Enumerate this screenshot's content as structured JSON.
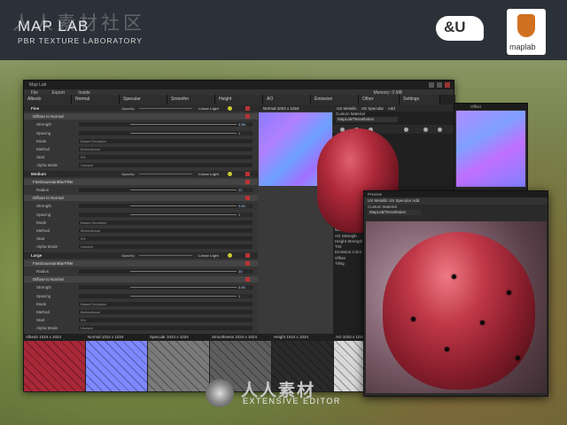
{
  "banner": {
    "title": "MAP LAB",
    "subtitle": "PBR TEXTURE LABORATORY",
    "watermark": "人人素材社区",
    "logo_amp": "&U",
    "logo_maplab": "maplab"
  },
  "main_window": {
    "title": "Map Lab",
    "menu": [
      "File",
      "Export",
      "Inside"
    ],
    "memory": "Memory: 0 MB",
    "tabs": [
      "Albedo",
      "Normal",
      "Specular",
      "Smoothn",
      "Height",
      "AO",
      "Emission",
      "Other",
      "Settings"
    ],
    "left_rows": [
      {
        "type": "h",
        "label": "Fine",
        "opacity": "Opacity",
        "blend": "Linear Light"
      },
      {
        "type": "sub",
        "label": "Diffuse to Normal"
      },
      {
        "type": "p",
        "label": "Strength",
        "num": "0.58"
      },
      {
        "type": "p",
        "label": "Spacing",
        "num": "1"
      },
      {
        "type": "p",
        "label": "Mode",
        "value": "Based Deviation"
      },
      {
        "type": "p",
        "label": "Method",
        "value": "Bidirectional"
      },
      {
        "type": "p",
        "label": "Start",
        "value": "5%"
      },
      {
        "type": "p",
        "label": "Alpha Mode",
        "value": "Unused"
      },
      {
        "type": "h",
        "label": "Medium",
        "opacity": "Opacity",
        "blend": "Linear Light"
      },
      {
        "type": "sub",
        "label": "FastGaussianBlurFilter"
      },
      {
        "type": "p",
        "label": "Radius",
        "num": "22"
      },
      {
        "type": "sub",
        "label": "Diffuse to Normal"
      },
      {
        "type": "p",
        "label": "Strength",
        "num": "0.60"
      },
      {
        "type": "p",
        "label": "Spacing",
        "num": "1"
      },
      {
        "type": "p",
        "label": "Mode",
        "value": "Based Deviation"
      },
      {
        "type": "p",
        "label": "Method",
        "value": "Bidirectional"
      },
      {
        "type": "p",
        "label": "Start",
        "value": "5%"
      },
      {
        "type": "p",
        "label": "Alpha Mode",
        "value": "Unused"
      },
      {
        "type": "h",
        "label": "Large",
        "opacity": "Opacity",
        "blend": "Linear Light"
      },
      {
        "type": "sub",
        "label": "FastGaussianBlurFilter"
      },
      {
        "type": "p",
        "label": "Radius",
        "num": "35"
      },
      {
        "type": "sub",
        "label": "Diffuse to Normal"
      },
      {
        "type": "p",
        "label": "Strength",
        "num": "0.65"
      },
      {
        "type": "p",
        "label": "Spacing",
        "num": "1"
      },
      {
        "type": "p",
        "label": "Mode",
        "value": "Based Deviation"
      },
      {
        "type": "p",
        "label": "Method",
        "value": "Bidirectional"
      },
      {
        "type": "p",
        "label": "Start",
        "value": "5%"
      },
      {
        "type": "p",
        "label": "Alpha Mode",
        "value": "Unused"
      }
    ],
    "normal_panel": {
      "header": "Normal 1024 x 1024"
    },
    "right_panel": {
      "tabs": [
        "US Metallic",
        "US Specular",
        "Add"
      ],
      "material": "Custom Material",
      "material_sel": "MapLab/Tessellation",
      "props": [
        "Settings",
        "Normal Strength",
        "AO Strength",
        "Height Strength",
        "Tint",
        "Emission Color",
        "Offset",
        "Tiling"
      ]
    },
    "thumbnails": [
      {
        "label": "Albedo 1024 x 1024",
        "color": "#a82838"
      },
      {
        "label": "Normal 1024 x 1024",
        "color": "#7f88ff"
      },
      {
        "label": "Specular 1024 x 1024",
        "color": "#7a7a7a"
      },
      {
        "label": "Smoothness 1024 x 1024",
        "color": "#5e5e5e"
      },
      {
        "label": "Height 1024 x 1024",
        "color": "#2a2a2a"
      },
      {
        "label": "AO 1024 x 1024",
        "color": "#d8d8d8"
      }
    ]
  },
  "small_window": {
    "title": "Offset"
  },
  "preview_window": {
    "title": "Preview",
    "tabs": "US Metallic    US Specular    Add",
    "material": "Custom Material",
    "material_sel": "MapLab/Tessellation"
  },
  "footer": {
    "brand": "人人素材",
    "editor": "EXTENSIVE EDITOR"
  },
  "colors": {
    "accent_yellow": "#cccc33",
    "close_red": "#bb3333",
    "banner": "#2b3138"
  }
}
